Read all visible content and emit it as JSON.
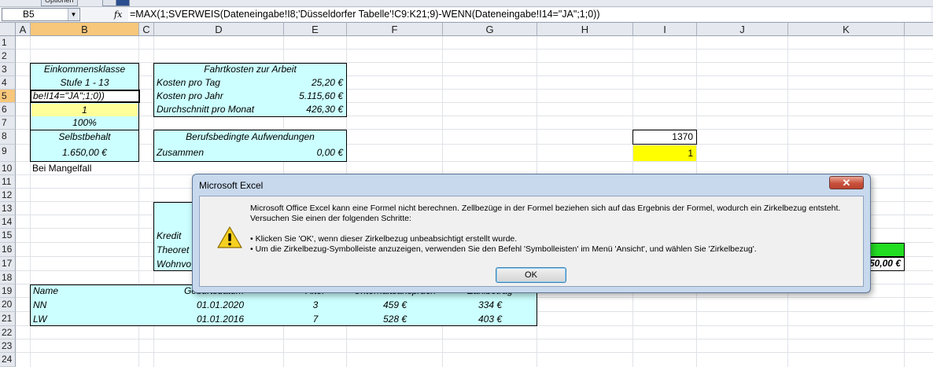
{
  "toolbar": {
    "options_label": "Optionen"
  },
  "formula_bar": {
    "name_box": "B5",
    "fx_label": "fx",
    "formula": "=MAX(1;SVERWEIS(Dateneingabe!I8;'Düsseldorfer Tabelle'!C9:K21;9)-WENN(Dateneingabe!I14=\"JA\";1;0))"
  },
  "columns": [
    "A",
    "B",
    "C",
    "D",
    "E",
    "F",
    "G",
    "H",
    "I",
    "J",
    "K"
  ],
  "rows": [
    "1",
    "2",
    "3",
    "4",
    "5",
    "6",
    "7",
    "8",
    "9",
    "10",
    "11",
    "12",
    "13",
    "14",
    "15",
    "16",
    "17",
    "18",
    "19",
    "20",
    "21",
    "22",
    "23",
    "24"
  ],
  "sheet": {
    "b3": "Einkommensklasse",
    "b4": "Stufe 1 - 13",
    "b5": "be!I14=\"JA\";1;0))",
    "b6": "1",
    "b7": "100%",
    "b8": "Selbstbehalt",
    "b9": "1.650,00 €",
    "a10": "Bei Mangelfall",
    "d3": "Fahrtkosten zur Arbeit",
    "d4": "Kosten pro Tag",
    "e4": "25,20 €",
    "d5": "Kosten pro Jahr",
    "e5": "5.115,60 €",
    "d6": "Durchschnitt pro Monat",
    "e6": "426,30 €",
    "d8": "Berufsbedingte Aufwendungen",
    "d9": "Zusammen",
    "e9": "0,00 €",
    "i8": "1370",
    "i9": "1",
    "d15": "Kredit",
    "d16": "Theoret",
    "d17": "Wohnvo",
    "k17": "50,00 €",
    "table_headers": {
      "name": "Name",
      "geburtsdatum": "Geburtsdatum",
      "alter": "Alter",
      "unterhalt": "Unterhaltsanspruch",
      "zahlbetrag": "Zahlbetrag"
    },
    "table_rows": [
      {
        "name": "NN",
        "geburtsdatum": "01.01.2020",
        "alter": "3",
        "unterhalt": "459 €",
        "zahlbetrag": "334 €"
      },
      {
        "name": "LW",
        "geburtsdatum": "01.01.2016",
        "alter": "7",
        "unterhalt": "528 €",
        "zahlbetrag": "403 €"
      }
    ]
  },
  "dialog": {
    "title": "Microsoft Excel",
    "close_glyph": "✕",
    "message_line1": "Microsoft Office Excel kann eine Formel nicht berechnen. Zellbezüge in der Formel beziehen sich auf das Ergebnis der Formel, wodurch ein Zirkelbezug entsteht.",
    "message_line2": "Versuchen Sie einen der folgenden Schritte:",
    "bullet1": "• Klicken Sie 'OK', wenn dieser Zirkelbezug unbeabsichtigt erstellt wurde.",
    "bullet2": "• Um die Zirkelbezug-Symbolleiste anzuzeigen, verwenden Sie den Befehl 'Symbolleisten' im Menü 'Ansicht', und wählen Sie 'Zirkelbezug'.",
    "ok_label": "OK",
    "icon": "warning-icon"
  },
  "colors": {
    "cyan": "#ccffff",
    "yellow": "#ffff00",
    "light_yellow": "#ffff99",
    "green": "#22dd22",
    "selected_header": "#f7c77b"
  }
}
